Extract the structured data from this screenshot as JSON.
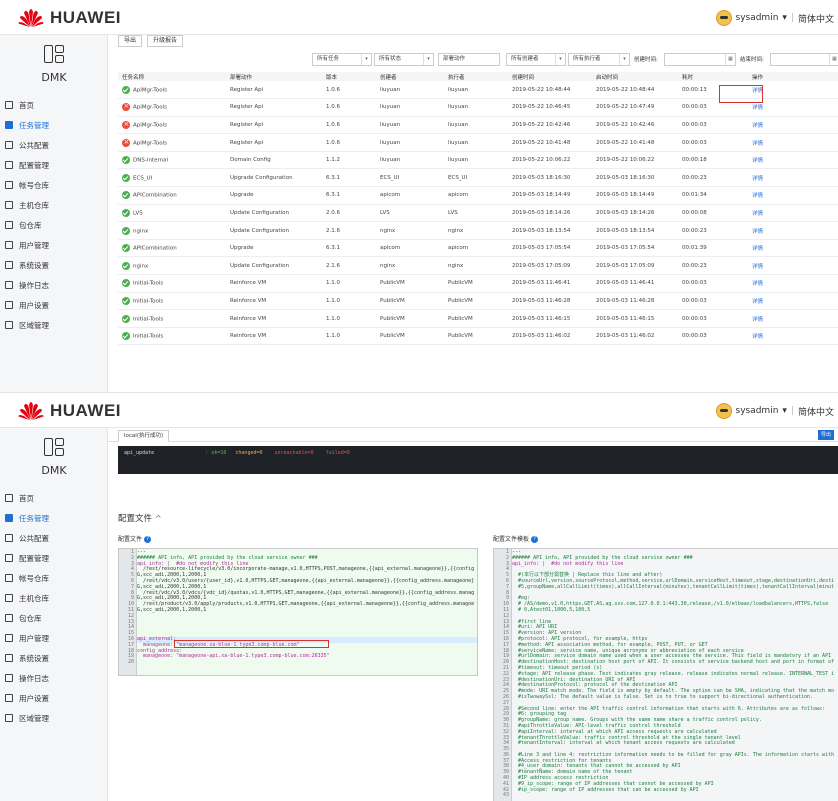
{
  "app": {
    "logo_text": "HUAWEI",
    "user": "sysadmin",
    "lang": "简体中文",
    "product": "DMK"
  },
  "nav": [
    {
      "label": "首页",
      "icon": "home-icon"
    },
    {
      "label": "任务管理",
      "icon": "task-icon",
      "active": true
    },
    {
      "label": "公共配置",
      "icon": "gear-icon"
    },
    {
      "label": "配置管理",
      "icon": "config-icon"
    },
    {
      "label": "帐号仓库",
      "icon": "account-icon"
    },
    {
      "label": "主机仓库",
      "icon": "host-icon"
    },
    {
      "label": "包仓库",
      "icon": "package-icon"
    },
    {
      "label": "用户管理",
      "icon": "users-icon"
    },
    {
      "label": "系统设置",
      "icon": "settings-icon"
    },
    {
      "label": "操作日志",
      "icon": "log-icon"
    },
    {
      "label": "用户设置",
      "icon": "user-settings-icon"
    },
    {
      "label": "区域管理",
      "icon": "cloud-icon"
    }
  ],
  "toolbar": {
    "export": "导出",
    "upgrade_report": "升级报告"
  },
  "filters": {
    "all_tasks": "所有任务",
    "all_status": "所有状态",
    "deploy_action": "部署动作",
    "all_creators": "所有创建者",
    "all_executors": "所有执行者",
    "created_time": "创建时间:",
    "end_time": "结束时间:"
  },
  "table": {
    "headers": [
      "任务名称",
      "部署动作",
      "版本",
      "创建者",
      "执行者",
      "创建时间",
      "启动时间",
      "耗时",
      "操作"
    ],
    "rows": [
      {
        "status": "ok",
        "name": "ApiMgr-Tools",
        "action": "Register Api",
        "version": "1.0.6",
        "creator": "liuyuan",
        "executor": "liuyuan",
        "created": "2019-05-22 10:48:44",
        "started": "2019-05-22 10:48:44",
        "duration": "00:00:13",
        "op": "详情"
      },
      {
        "status": "fail",
        "name": "ApiMgr-Tools",
        "action": "Register Api",
        "version": "1.0.6",
        "creator": "liuyuan",
        "executor": "liuyuan",
        "created": "2019-05-22 10:46:45",
        "started": "2019-05-22 10:47:49",
        "duration": "00:00:03",
        "op": "详情"
      },
      {
        "status": "fail",
        "name": "ApiMgr-Tools",
        "action": "Register Api",
        "version": "1.0.6",
        "creator": "liuyuan",
        "executor": "liuyuan",
        "created": "2019-05-22 10:42:46",
        "started": "2019-05-22 10:42:46",
        "duration": "00:00:03",
        "op": "详情"
      },
      {
        "status": "fail",
        "name": "ApiMgr-Tools",
        "action": "Register Api",
        "version": "1.0.6",
        "creator": "liuyuan",
        "executor": "liuyuan",
        "created": "2019-05-22 10:41:48",
        "started": "2019-05-22 10:41:48",
        "duration": "00:00:03",
        "op": "详情"
      },
      {
        "status": "ok",
        "name": "DNS-Internal",
        "action": "Domain Config",
        "version": "1.1.2",
        "creator": "liuyuan",
        "executor": "liuyuan",
        "created": "2019-05-22 10:06:22",
        "started": "2019-05-22 10:06:22",
        "duration": "00:00:18",
        "op": "详情"
      },
      {
        "status": "ok",
        "name": "ECS_UI",
        "action": "Upgrade Configuration",
        "version": "6.3.1",
        "creator": "ECS_UI",
        "executor": "ECS_UI",
        "created": "2019-05-03 18:16:30",
        "started": "2019-05-03 18:16:30",
        "duration": "00:00:23",
        "op": "详情"
      },
      {
        "status": "ok",
        "name": "APICombination",
        "action": "Upgrade",
        "version": "6.3.1",
        "creator": "apicom",
        "executor": "apicom",
        "created": "2019-05-03 18:14:49",
        "started": "2019-05-03 18:14:49",
        "duration": "00:01:34",
        "op": "详情"
      },
      {
        "status": "ok",
        "name": "LVS",
        "action": "Update Configuration",
        "version": "2.0.6",
        "creator": "LVS",
        "executor": "LVS",
        "created": "2019-05-03 18:14:26",
        "started": "2019-05-03 18:14:26",
        "duration": "00:00:08",
        "op": "详情"
      },
      {
        "status": "ok",
        "name": "nginx",
        "action": "Update Configuration",
        "version": "2.1.6",
        "creator": "nginx",
        "executor": "nginx",
        "created": "2019-05-03 18:13:54",
        "started": "2019-05-03 18:13:54",
        "duration": "00:00:23",
        "op": "详情"
      },
      {
        "status": "ok",
        "name": "APICombination",
        "action": "Upgrade",
        "version": "6.3.1",
        "creator": "apicom",
        "executor": "apicom",
        "created": "2019-05-03 17:05:54",
        "started": "2019-05-03 17:05:54",
        "duration": "00:01:39",
        "op": "详情"
      },
      {
        "status": "ok",
        "name": "nginx",
        "action": "Update Configuration",
        "version": "2.1.6",
        "creator": "nginx",
        "executor": "nginx",
        "created": "2019-05-03 17:05:09",
        "started": "2019-05-03 17:05:09",
        "duration": "00:00:23",
        "op": "详情"
      },
      {
        "status": "ok",
        "name": "Initial-Tools",
        "action": "Reinforce VM",
        "version": "1.1.0",
        "creator": "PublicVM",
        "executor": "PublicVM",
        "created": "2019-05-03 11:46:41",
        "started": "2019-05-03 11:46:41",
        "duration": "00:00:03",
        "op": "详情"
      },
      {
        "status": "ok",
        "name": "Initial-Tools",
        "action": "Reinforce VM",
        "version": "1.1.0",
        "creator": "PublicVM",
        "executor": "PublicVM",
        "created": "2019-05-03 11:46:28",
        "started": "2019-05-03 11:46:28",
        "duration": "00:00:03",
        "op": "详情"
      },
      {
        "status": "ok",
        "name": "Initial-Tools",
        "action": "Reinforce VM",
        "version": "1.1.0",
        "creator": "PublicVM",
        "executor": "PublicVM",
        "created": "2019-05-03 11:46:15",
        "started": "2019-05-03 11:46:15",
        "duration": "00:00:03",
        "op": "详情"
      },
      {
        "status": "ok",
        "name": "Initial-Tools",
        "action": "Reinforce VM",
        "version": "1.1.0",
        "creator": "PublicVM",
        "executor": "PublicVM",
        "created": "2019-05-03 11:46:02",
        "started": "2019-05-03 11:46:02",
        "duration": "00:00:03",
        "op": "详情"
      }
    ]
  },
  "detail": {
    "tab": "local(执行成功)",
    "export": "导出",
    "console_host": "api_update",
    "console_ok": ": ok=10",
    "console_changed": "changed=0",
    "console_unreachable": "unreachable=0",
    "console_failed": "failed=0",
    "section_title": "配置文件",
    "left_label": "配置文件",
    "right_label": "配置文件模板",
    "left_lines": [
      "---",
      "###### API info, API provided by the cloud service owner ###",
      "api_info: |  #do not modify this line",
      "  /rest/resource-lifecycle/v3.0/incorporate-manage,v1.0,HTTPS,POST,manageone,{{api_external.manageone}},{{config",
      "G,scc_adi,2000,1,2000,1",
      "  /rest/vdc/v3.0/users/{user_id},v1.0,HTTPS,GET,manageone,{{api_external.manageone}},{{config_address.manageone}",
      "G,scc_adi,2000,1,2000,1",
      "  /rest/vdc/v3.0/vdcs/{vdc_id}/quotas,v1.0,HTTPS,GET,manageone,{{api_external.manageone}},{{config_address.manag",
      "G,scc_adi,2000,1,2000,1",
      "  /rest/product/v3.0/apply/products,v1.0,HTTPS,GET,manageone,{{api_external.manageone}},{{config_address.managoe",
      "G,scc_adi,2000,1,2000,1",
      "",
      "",
      "",
      "",
      "api_external:",
      "  manageone: \"manageone.xa-blue-1.type3.comp-blue.com\"",
      "config_address:",
      "  manageone: \"manageone-api.xa-blue-1.type3.comp-blue.com:26335\"",
      ""
    ],
    "right_lines": [
      "---",
      "###### API info, API provided by the cloud service owner ###",
      "api_info: |  #do not modify this line",
      "",
      "  #(本行以下部分需替换 | Replace this line and after)",
      "  #sourceUrl,version,sourceProtocol,method,service,urlDomain,serviceHost,timeout,stage,destinationUri,desti",
      "  #5,groupName,allCallLimit(times),allCallInterval(minutes),tenantCallLimit(times),tenantCallInterval(minut",
      "",
      "  #eg:",
      "  # /AS/demo,v1.0,https,GET,AS,ag.xxx.com,127.0.0.1:443,30,release,/v1.0/elbaas/loadbalancers,HTTPS,false",
      "  # 0,Atest01,1000,5,100,5",
      "",
      "  #first line",
      "  #uri: API URI",
      "  #version: API version",
      "  #protocol: API protocol, for example, https",
      "  #method: API association method, for example, POST, PUT, or GET",
      "  #serviceName: service name, unique acronyms or abbreviation of each service",
      "  #urlDomain: service domain name used when a user accesses the service. This field is mandatory if an API",
      "  #destinationHost: destination host port of API. It consists of service backend host and port in format of",
      "  #timeout: timeout period (s)",
      "  #stage: API release phase. Test indicates gray release. release indicates normal release. INTERNAL_TEST i",
      "  #destinationUri: destination URI of API",
      "  #destinationProtocol: protocol of the destination API",
      "  #mode: URI match mode. The field is empty by default. The option can be SHA, indicating that the match mo",
      "  #isTwowaySsl: The default value is false. Set is to true to support bi-directional authentication.",
      "",
      "  #Second line: enter the API traffic control information that starts with 6. Attributes are as follows:",
      "  #6: grouping tag",
      "  #groupName: group name. Groups with the same name share a traffic control policy.",
      "  #apiThrottleValue: API-level traffic control threshold",
      "  #apiInterval: interval at which API access requests are calculated",
      "  #tenantThrottleValue: traffic control threshold at the single tenant level",
      "  #tenantInterval: interval at which tenant access requests are calculated",
      "",
      "  #Line 3 and line 4: restriction information needs to be filled for gray APIs. The information starts with",
      "  #Access restriction for tenants",
      "  #4_user_domain: tenants that cannot be accessed by API",
      "  #tenantName: domain name of the tenant",
      "  #IP address access restriction",
      "  #9_ip_scope: range of IP addresses that cannot be accessed by API",
      "  #ip_scope: range of IP addresses that can be accessed by API",
      ""
    ]
  }
}
